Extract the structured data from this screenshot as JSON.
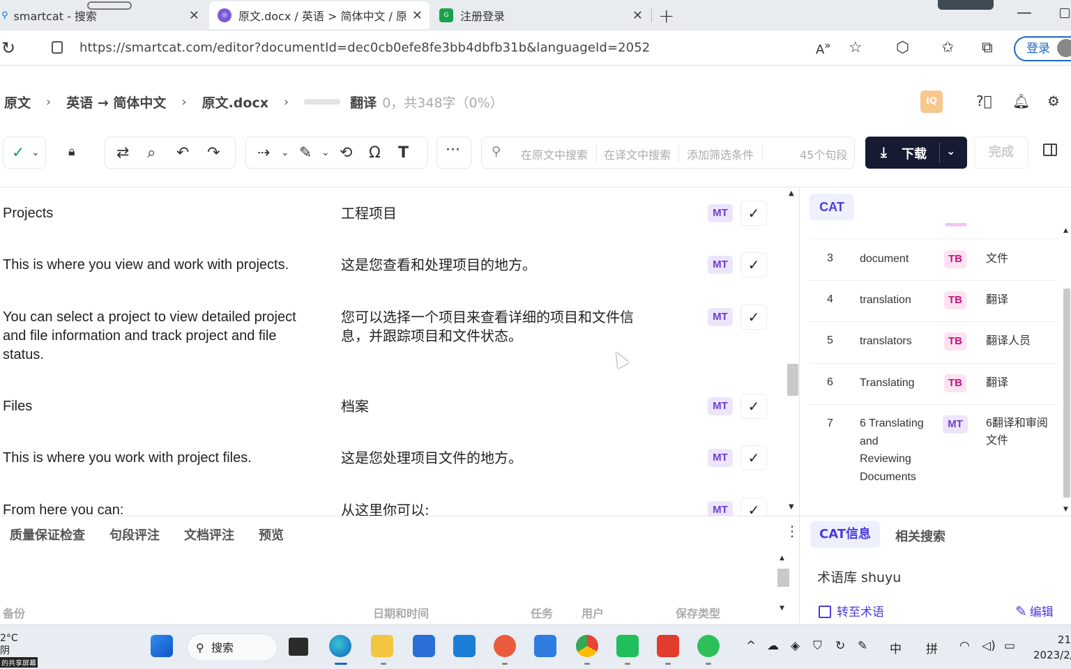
{
  "browser": {
    "tabs": [
      {
        "title": "smartcat - 搜索"
      },
      {
        "title": "原文.docx / 英语 > 简体中文 / 原"
      },
      {
        "title": "注册登录"
      }
    ],
    "url": "https://smartcat.com/editor?documentId=dec0cb0efe8fe3bb4dbfb31b&languageId=2052",
    "login_label": "登录"
  },
  "header": {
    "crumbs": [
      "原文",
      "英语 → 简体中文",
      "原文.docx"
    ],
    "mode": "翻译",
    "stats": "0，共348字（0%）",
    "iq_badge": "IQ"
  },
  "toolbar": {
    "search_source": "在原文中搜索",
    "search_target": "在译文中搜索",
    "add_filter": "添加筛选条件",
    "segment_count": "45个句段",
    "download_label": "下载",
    "done_label": "完成"
  },
  "segments": [
    {
      "source": "Projects",
      "target": "工程项目",
      "badge": "MT"
    },
    {
      "source": "This is where you view and work with projects.",
      "target": "这是您查看和处理项目的地方。",
      "badge": "MT"
    },
    {
      "source": "You can select a project to  view detailed project and file information and track project and file status.",
      "target": "您可以选择一个项目来查看详细的项目和文件信息，并跟踪项目和文件状态。",
      "badge": "MT"
    },
    {
      "source": "Files",
      "target": "档案",
      "badge": "MT"
    },
    {
      "source": "This is where you work with project files.",
      "target": "这是您处理项目文件的地方。",
      "badge": "MT"
    },
    {
      "source": "From here you can:",
      "target": "从这里你可以:",
      "badge": "MT"
    }
  ],
  "cat": {
    "tab_label": "CAT",
    "rows": [
      {
        "num": "3",
        "term": "document",
        "badge": "TB",
        "translation": "文件"
      },
      {
        "num": "4",
        "term": "translation",
        "badge": "TB",
        "translation": "翻译"
      },
      {
        "num": "5",
        "term": "translators",
        "badge": "TB",
        "translation": "翻译人员"
      },
      {
        "num": "6",
        "term": "Translating",
        "badge": "TB",
        "translation": "翻译"
      },
      {
        "num": "7",
        "term": "6 Translating and Reviewing Documents",
        "badge": "MT",
        "translation": "6翻译和审阅文件"
      }
    ]
  },
  "bottom": {
    "tabs": [
      "质量保证检查",
      "句段评注",
      "文档评注",
      "预览"
    ],
    "columns": {
      "backup": "备份",
      "datetime": "日期和时间",
      "task": "任务",
      "user": "用户",
      "save_type": "保存类型"
    }
  },
  "cat_info": {
    "tab_info": "CAT信息",
    "tab_related": "相关搜索",
    "termbase": "术语库 shuyu",
    "goto_terms": "转至术语",
    "edit": "编辑"
  },
  "taskbar": {
    "weather_temp": "2°C",
    "weather_desc": "阴",
    "share_label": "的共享屏幕",
    "search_label": "搜索",
    "ime_lang": "中",
    "ime_mode": "拼",
    "time": "21",
    "date": "2023/2/"
  }
}
